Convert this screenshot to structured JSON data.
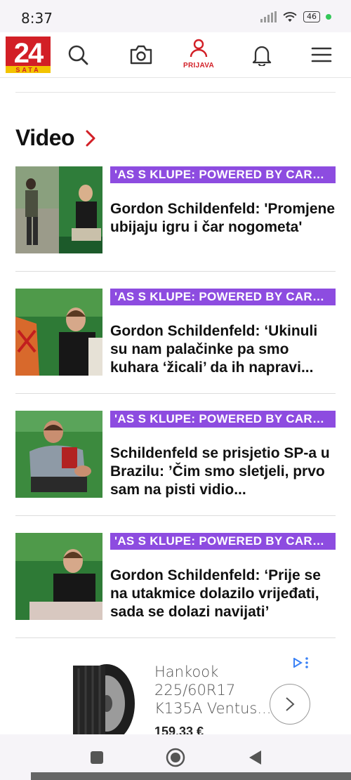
{
  "status_bar": {
    "time": "8:37",
    "battery": "46"
  },
  "header": {
    "logo_text_big": "24",
    "logo_text_small": "SATA",
    "login_label": "PRIJAVA"
  },
  "section": {
    "title": "Video"
  },
  "articles": [
    {
      "kicker": "'AS S KLUPE: POWERED BY CARLSBERG'",
      "headline": "Gordon Schildenfeld: 'Promjene ubijaju igru i čar nogometa'"
    },
    {
      "kicker": "'AS S KLUPE: POWERED BY CARLSBERG'",
      "headline": "Gordon Schildenfeld: ‘Ukinuli su nam palačinke pa smo kuhara ‘žicali’ da ih napravi..."
    },
    {
      "kicker": "'AS S KLUPE: POWERED BY CARLSBERG'",
      "headline": "Schildenfeld se prisjetio SP-a u Brazilu: ’Čim smo sletjeli, prvo sam na pisti vidio..."
    },
    {
      "kicker": "'AS S KLUPE: POWERED BY CARLSBERG'",
      "headline": "Gordon Schildenfeld: ‘Prije se na utakmice dolazilo vrijeđati, sada se dolazi navijati’"
    }
  ],
  "ad": {
    "text": "Hankook 225/60R17 K135A Ventus...",
    "price": "159,33 €"
  },
  "colors": {
    "brand_red": "#d21f26",
    "kicker_purple": "#8d4ce0"
  }
}
